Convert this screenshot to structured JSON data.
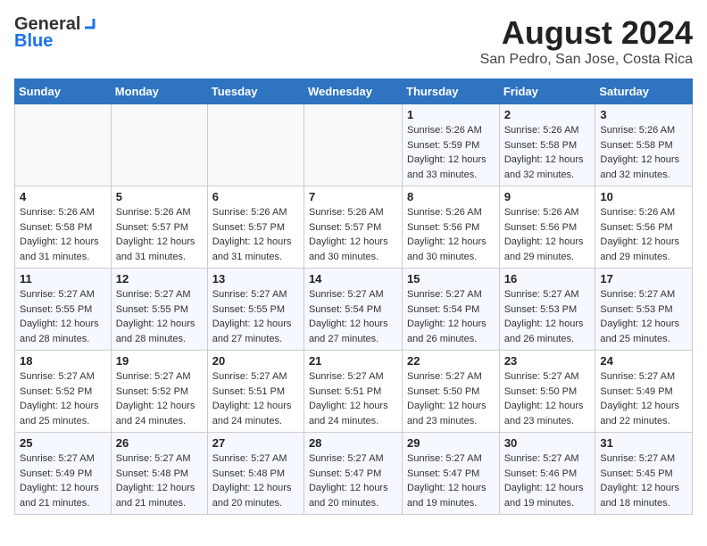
{
  "header": {
    "logo_general": "General",
    "logo_blue": "Blue",
    "month_year": "August 2024",
    "location": "San Pedro, San Jose, Costa Rica"
  },
  "days_of_week": [
    "Sunday",
    "Monday",
    "Tuesday",
    "Wednesday",
    "Thursday",
    "Friday",
    "Saturday"
  ],
  "weeks": [
    [
      {
        "day": "",
        "info": ""
      },
      {
        "day": "",
        "info": ""
      },
      {
        "day": "",
        "info": ""
      },
      {
        "day": "",
        "info": ""
      },
      {
        "day": "1",
        "info": "Sunrise: 5:26 AM\nSunset: 5:59 PM\nDaylight: 12 hours\nand 33 minutes."
      },
      {
        "day": "2",
        "info": "Sunrise: 5:26 AM\nSunset: 5:58 PM\nDaylight: 12 hours\nand 32 minutes."
      },
      {
        "day": "3",
        "info": "Sunrise: 5:26 AM\nSunset: 5:58 PM\nDaylight: 12 hours\nand 32 minutes."
      }
    ],
    [
      {
        "day": "4",
        "info": "Sunrise: 5:26 AM\nSunset: 5:58 PM\nDaylight: 12 hours\nand 31 minutes."
      },
      {
        "day": "5",
        "info": "Sunrise: 5:26 AM\nSunset: 5:57 PM\nDaylight: 12 hours\nand 31 minutes."
      },
      {
        "day": "6",
        "info": "Sunrise: 5:26 AM\nSunset: 5:57 PM\nDaylight: 12 hours\nand 31 minutes."
      },
      {
        "day": "7",
        "info": "Sunrise: 5:26 AM\nSunset: 5:57 PM\nDaylight: 12 hours\nand 30 minutes."
      },
      {
        "day": "8",
        "info": "Sunrise: 5:26 AM\nSunset: 5:56 PM\nDaylight: 12 hours\nand 30 minutes."
      },
      {
        "day": "9",
        "info": "Sunrise: 5:26 AM\nSunset: 5:56 PM\nDaylight: 12 hours\nand 29 minutes."
      },
      {
        "day": "10",
        "info": "Sunrise: 5:26 AM\nSunset: 5:56 PM\nDaylight: 12 hours\nand 29 minutes."
      }
    ],
    [
      {
        "day": "11",
        "info": "Sunrise: 5:27 AM\nSunset: 5:55 PM\nDaylight: 12 hours\nand 28 minutes."
      },
      {
        "day": "12",
        "info": "Sunrise: 5:27 AM\nSunset: 5:55 PM\nDaylight: 12 hours\nand 28 minutes."
      },
      {
        "day": "13",
        "info": "Sunrise: 5:27 AM\nSunset: 5:55 PM\nDaylight: 12 hours\nand 27 minutes."
      },
      {
        "day": "14",
        "info": "Sunrise: 5:27 AM\nSunset: 5:54 PM\nDaylight: 12 hours\nand 27 minutes."
      },
      {
        "day": "15",
        "info": "Sunrise: 5:27 AM\nSunset: 5:54 PM\nDaylight: 12 hours\nand 26 minutes."
      },
      {
        "day": "16",
        "info": "Sunrise: 5:27 AM\nSunset: 5:53 PM\nDaylight: 12 hours\nand 26 minutes."
      },
      {
        "day": "17",
        "info": "Sunrise: 5:27 AM\nSunset: 5:53 PM\nDaylight: 12 hours\nand 25 minutes."
      }
    ],
    [
      {
        "day": "18",
        "info": "Sunrise: 5:27 AM\nSunset: 5:52 PM\nDaylight: 12 hours\nand 25 minutes."
      },
      {
        "day": "19",
        "info": "Sunrise: 5:27 AM\nSunset: 5:52 PM\nDaylight: 12 hours\nand 24 minutes."
      },
      {
        "day": "20",
        "info": "Sunrise: 5:27 AM\nSunset: 5:51 PM\nDaylight: 12 hours\nand 24 minutes."
      },
      {
        "day": "21",
        "info": "Sunrise: 5:27 AM\nSunset: 5:51 PM\nDaylight: 12 hours\nand 24 minutes."
      },
      {
        "day": "22",
        "info": "Sunrise: 5:27 AM\nSunset: 5:50 PM\nDaylight: 12 hours\nand 23 minutes."
      },
      {
        "day": "23",
        "info": "Sunrise: 5:27 AM\nSunset: 5:50 PM\nDaylight: 12 hours\nand 23 minutes."
      },
      {
        "day": "24",
        "info": "Sunrise: 5:27 AM\nSunset: 5:49 PM\nDaylight: 12 hours\nand 22 minutes."
      }
    ],
    [
      {
        "day": "25",
        "info": "Sunrise: 5:27 AM\nSunset: 5:49 PM\nDaylight: 12 hours\nand 21 minutes."
      },
      {
        "day": "26",
        "info": "Sunrise: 5:27 AM\nSunset: 5:48 PM\nDaylight: 12 hours\nand 21 minutes."
      },
      {
        "day": "27",
        "info": "Sunrise: 5:27 AM\nSunset: 5:48 PM\nDaylight: 12 hours\nand 20 minutes."
      },
      {
        "day": "28",
        "info": "Sunrise: 5:27 AM\nSunset: 5:47 PM\nDaylight: 12 hours\nand 20 minutes."
      },
      {
        "day": "29",
        "info": "Sunrise: 5:27 AM\nSunset: 5:47 PM\nDaylight: 12 hours\nand 19 minutes."
      },
      {
        "day": "30",
        "info": "Sunrise: 5:27 AM\nSunset: 5:46 PM\nDaylight: 12 hours\nand 19 minutes."
      },
      {
        "day": "31",
        "info": "Sunrise: 5:27 AM\nSunset: 5:45 PM\nDaylight: 12 hours\nand 18 minutes."
      }
    ]
  ]
}
